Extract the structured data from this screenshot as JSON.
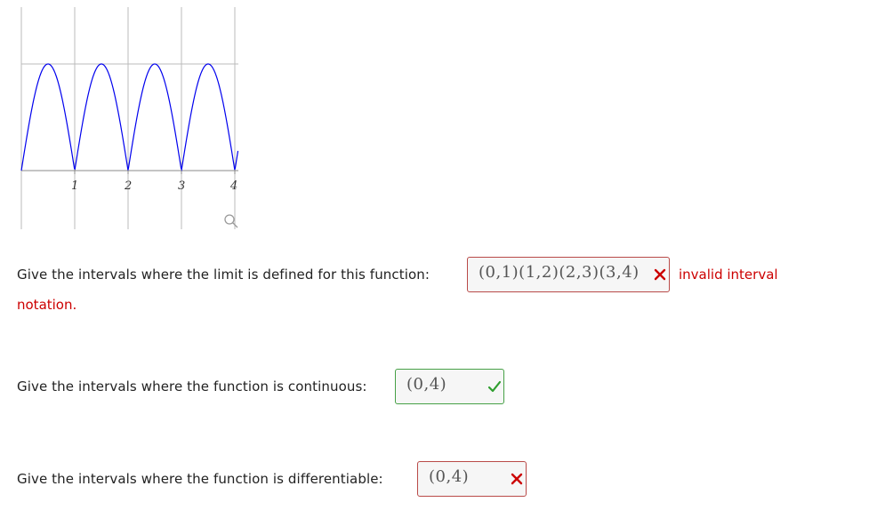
{
  "graph": {
    "x_tick_labels": [
      "1",
      "2",
      "3",
      "4"
    ],
    "curve_color": "#0000ee",
    "grid_color": "#bbbbbb",
    "zoom_icon": "zoom-magnifier-icon"
  },
  "questions": [
    {
      "prompt": "Give the intervals where the limit is defined for this function:",
      "answer": "(0,1)(1,2)(2,3)(3,4)",
      "status": "incorrect",
      "feedback_line1": "invalid interval",
      "feedback_line2": "notation."
    },
    {
      "prompt": "Give the intervals where the function is continuous:",
      "answer": "(0,4)",
      "status": "correct"
    },
    {
      "prompt": "Give the intervals where the function is differentiable:",
      "answer": "(0,4)",
      "status": "incorrect"
    }
  ],
  "colors": {
    "correct": "#46a046",
    "incorrect": "#b94a48",
    "feedback_text": "#cc0000"
  }
}
